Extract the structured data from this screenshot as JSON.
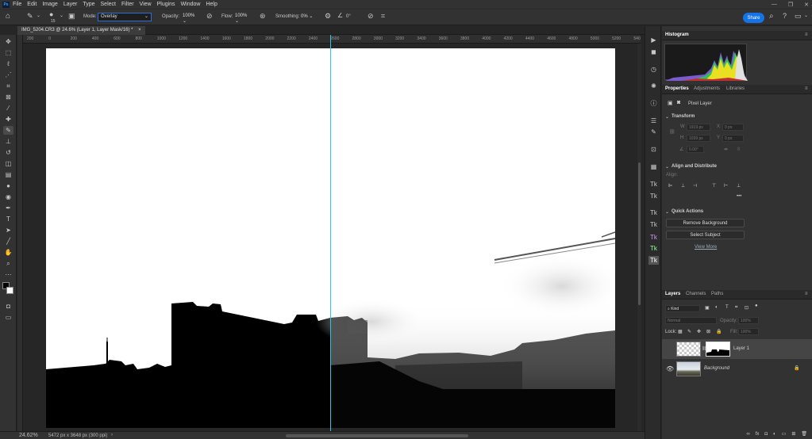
{
  "app": {
    "logo": "Ps"
  },
  "menu": [
    "File",
    "Edit",
    "Image",
    "Layer",
    "Type",
    "Select",
    "Filter",
    "View",
    "Plugins",
    "Window",
    "Help"
  ],
  "window_controls": [
    "—",
    "❐",
    "✕"
  ],
  "options_bar": {
    "brush_size": "15",
    "mode_label": "Mode:",
    "mode_value": "Overlay",
    "opacity_label": "Opacity:",
    "opacity_value": "100%",
    "flow_label": "Flow:",
    "flow_value": "100%",
    "smoothing_label": "Smoothing:",
    "smoothing_value": "0%",
    "angle_value": "0°",
    "share_label": "Share"
  },
  "document": {
    "tab_title": "IMG_5204.CR3 @ 24.6% (Layer 1, Layer Mask/16) *",
    "close": "×"
  },
  "ruler_ticks": [
    "200",
    "0",
    "200",
    "400",
    "600",
    "800",
    "1000",
    "1200",
    "1400",
    "1600",
    "1800",
    "2000",
    "2200",
    "2400",
    "2600",
    "2800",
    "3000",
    "3200",
    "3400",
    "3600",
    "3800",
    "4000",
    "4200",
    "4400",
    "4600",
    "4800",
    "5000",
    "5200",
    "540"
  ],
  "status": {
    "zoom": "24.62%",
    "doc_size": "5472 px x 3648 px (300 ppi)",
    "arrow": "›"
  },
  "histogram": {
    "title": "Histogram"
  },
  "properties": {
    "tabs": [
      "Properties",
      "Adjustments",
      "Libraries"
    ],
    "layer_type": "Pixel Layer",
    "transform_title": "Transform",
    "w_label": "W",
    "w_value": "1919 px",
    "x_label": "X",
    "x_value": "0 px",
    "h_label": "H",
    "h_value": "1039 px",
    "y_label": "Y",
    "y_value": "0 px",
    "angle_value": "0.00°",
    "align_title": "Align and Distribute",
    "align_label": "Align:",
    "more": "•••",
    "quick_title": "Quick Actions",
    "remove_bg": "Remove Background",
    "select_subject": "Select Subject",
    "view_more": "View More"
  },
  "layers": {
    "tabs": [
      "Layers",
      "Channels",
      "Paths"
    ],
    "kind_label": "Kind",
    "blend_mode": "Normal",
    "opacity_label": "Opacity:",
    "opacity_value": "100%",
    "lock_label": "Lock:",
    "fill_label": "Fill:",
    "fill_value": "100%",
    "items": [
      {
        "name": "Layer 1",
        "selected": true,
        "visible": false
      },
      {
        "name": "Background",
        "selected": false,
        "visible": true,
        "locked": true
      }
    ],
    "footer_icons": [
      "∞",
      "fx",
      "◘",
      "◐",
      "▭",
      "⊞",
      "🗑"
    ]
  },
  "colors": {
    "accent": "#1473e6",
    "guide": "#28c8e6",
    "panel": "#323232",
    "dark": "#262626"
  }
}
